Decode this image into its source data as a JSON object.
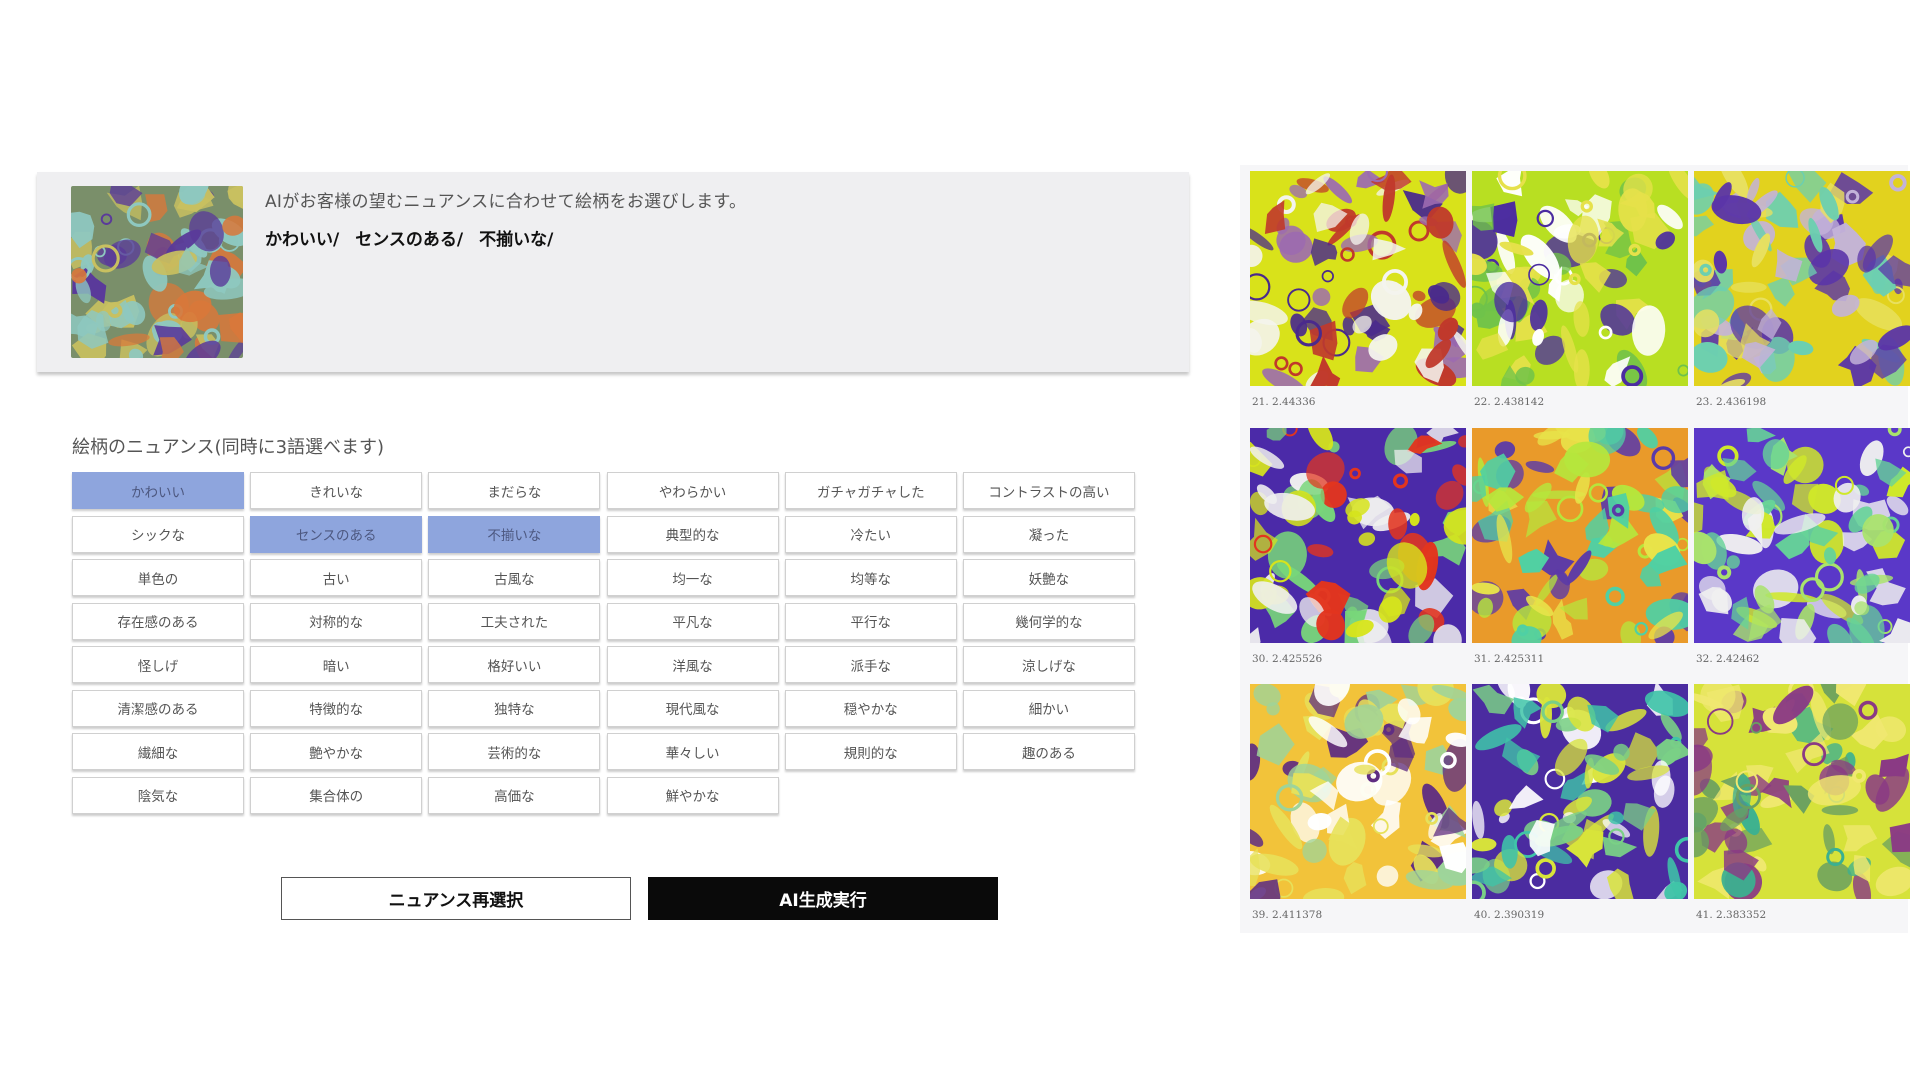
{
  "header": {
    "description": "AIがお客様の望むニュアンスに合わせて絵柄をお選びします。",
    "selected_tags": [
      "かわいい/",
      "センスのある/",
      "不揃いな/"
    ],
    "thumbnail_icon": "floral-pattern-thumbnail"
  },
  "nuance": {
    "title": "絵柄のニュアンス(同時に3語選べます)",
    "options": [
      "かわいい",
      "きれいな",
      "まだらな",
      "やわらかい",
      "ガチャガチャした",
      "コントラストの高い",
      "シックな",
      "センスのある",
      "不揃いな",
      "典型的な",
      "冷たい",
      "凝った",
      "単色の",
      "古い",
      "古風な",
      "均一な",
      "均等な",
      "妖艶な",
      "存在感のある",
      "対称的な",
      "工夫された",
      "平凡な",
      "平行な",
      "幾何学的な",
      "怪しげ",
      "暗い",
      "格好いい",
      "洋風な",
      "派手な",
      "涼しげな",
      "清潔感のある",
      "特徴的な",
      "独特な",
      "現代風な",
      "穏やかな",
      "細かい",
      "繊細な",
      "艶やかな",
      "芸術的な",
      "華々しい",
      "規則的な",
      "趣のある",
      "陰気な",
      "集合体の",
      "高価な",
      "鮮やかな"
    ],
    "selected": [
      "かわいい",
      "センスのある",
      "不揃いな"
    ],
    "selected_color": "#8ea5dd"
  },
  "actions": {
    "reselect_label": "ニュアンス再選択",
    "generate_label": "AI生成実行"
  },
  "results": [
    {
      "caption": "21. 2.44336",
      "palette": [
        "#d9e21a",
        "#4a2a8c",
        "#f4f4ee",
        "#c0392b",
        "#9c6bb0"
      ]
    },
    {
      "caption": "22. 2.438142",
      "palette": [
        "#b8df22",
        "#4b2ca0",
        "#6fc24a",
        "#e6e14a",
        "#ffffff"
      ]
    },
    {
      "caption": "23. 2.436198",
      "palette": [
        "#e2d21e",
        "#5b35a8",
        "#6ccfb0",
        "#c3b3d9",
        "#e8e060"
      ]
    },
    {
      "caption": "30. 2.425526",
      "palette": [
        "#4b2aa8",
        "#d6e41c",
        "#e2351e",
        "#78d67a",
        "#f0f0f0"
      ]
    },
    {
      "caption": "31. 2.425311",
      "palette": [
        "#e99a2a",
        "#b6e63c",
        "#5b3aa8",
        "#4fd0a4",
        "#e8e44a"
      ]
    },
    {
      "caption": "32. 2.42462",
      "palette": [
        "#5a38c8",
        "#cfe82a",
        "#66d398",
        "#f0f0f0",
        "#a9e36c"
      ]
    },
    {
      "caption": "39. 2.411378",
      "palette": [
        "#f2c33a",
        "#5f2d82",
        "#9ed49a",
        "#e7e15a",
        "#ffffff"
      ]
    },
    {
      "caption": "40. 2.390319",
      "palette": [
        "#4b2ca0",
        "#3fc4a8",
        "#d8e43a",
        "#ffffff",
        "#7ad086"
      ]
    },
    {
      "caption": "41. 2.383352",
      "palette": [
        "#d6e23a",
        "#8a3a84",
        "#6aa060",
        "#f0e870",
        "#3bb090"
      ]
    }
  ]
}
